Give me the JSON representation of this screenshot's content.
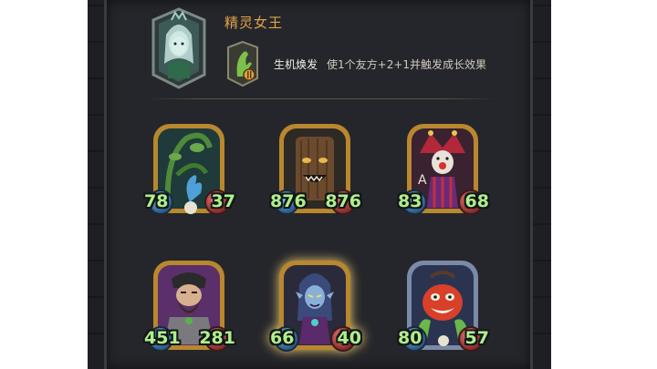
{
  "hero": {
    "name": "精灵女王",
    "skill_name": "生机焕发",
    "skill_desc": "使1个友方+2+1并触发成长效果"
  },
  "cards": [
    {
      "id": "vine-sprout",
      "atk": "78",
      "hp": "37"
    },
    {
      "id": "treant",
      "atk": "876",
      "hp": "876"
    },
    {
      "id": "jester",
      "atk": "83",
      "hp": "68"
    },
    {
      "id": "bearded-warrior",
      "atk": "451",
      "hp": "281"
    },
    {
      "id": "dark-elf",
      "atk": "66",
      "hp": "40"
    },
    {
      "id": "red-imp",
      "atk": "80",
      "hp": "57"
    }
  ],
  "colors": {
    "frame_gold": "#c9973c",
    "stat_green": "#aef08a",
    "hero_name": "#e0a248",
    "panel_bg": "#25262b"
  }
}
